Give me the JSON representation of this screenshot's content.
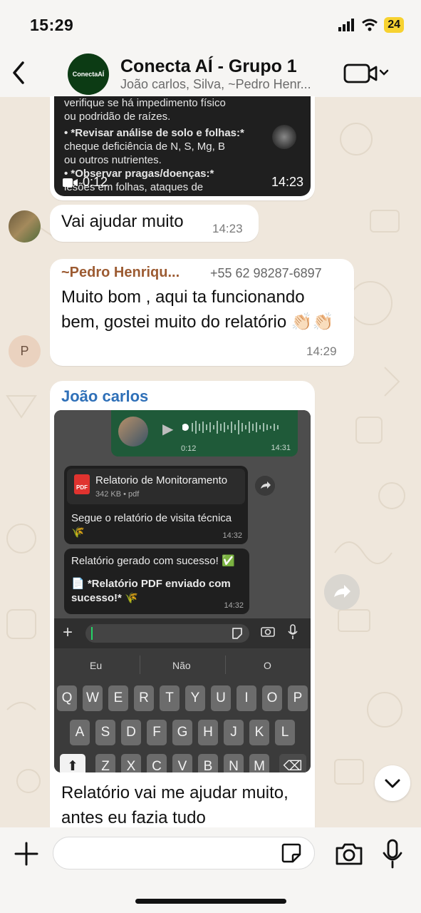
{
  "status_bar": {
    "time": "15:29",
    "battery": "24"
  },
  "header": {
    "avatar_text": "ConectaAÍ",
    "title": "Conecta AÍ - Grupo 1",
    "members": "João carlos, Silva, ~Pedro Henr..."
  },
  "video_message": {
    "lines": [
      "verifique se há impedimento físico",
      "ou podridão de raízes.",
      "• *Revisar análise de solo e folhas:*",
      "cheque deficiência de N, S, Mg, B",
      "ou outros nutrientes.",
      "• *Observar pragas/doenças:*",
      "lesões em folhas, ataques de"
    ],
    "duration": "0:12",
    "time": "14:23"
  },
  "message_1": {
    "text": "Vai ajudar muito",
    "time": "14:23"
  },
  "message_2": {
    "sender": "~Pedro Henriqu...",
    "phone": "+55 62 98287-6897",
    "text": "Muito bom , aqui ta funcionando bem, gostei muito do relatório 👏🏻👏🏻",
    "time": "14:29",
    "avatar_letter": "P"
  },
  "message_3": {
    "sender": "João carlos",
    "text": "Relatório vai me ajudar muito, antes eu fazia tudo",
    "screenshot": {
      "audio": {
        "duration": "0:12",
        "time": "14:31"
      },
      "pdf": {
        "icon_label": "PDF",
        "name": "Relatorio de Monitoramento",
        "meta": "342 KB • pdf",
        "caption": "Segue o relatório de visita técnica 🌾",
        "time": "14:32"
      },
      "success": {
        "line1": "Relatório gerado com sucesso! ✅",
        "line2": "📄 *Relatório PDF enviado com sucesso!* 🌾",
        "time": "14:32"
      },
      "suggestions": [
        "Eu",
        "Não",
        "O"
      ],
      "keys_row1": [
        "Q",
        "W",
        "E",
        "R",
        "T",
        "Y",
        "U",
        "I",
        "O",
        "P"
      ],
      "keys_row2": [
        "A",
        "S",
        "D",
        "F",
        "G",
        "H",
        "J",
        "K",
        "L"
      ],
      "keys_row3": [
        "Z",
        "X",
        "C",
        "V",
        "B",
        "N",
        "M"
      ]
    }
  },
  "composer": {
    "placeholder": ""
  }
}
